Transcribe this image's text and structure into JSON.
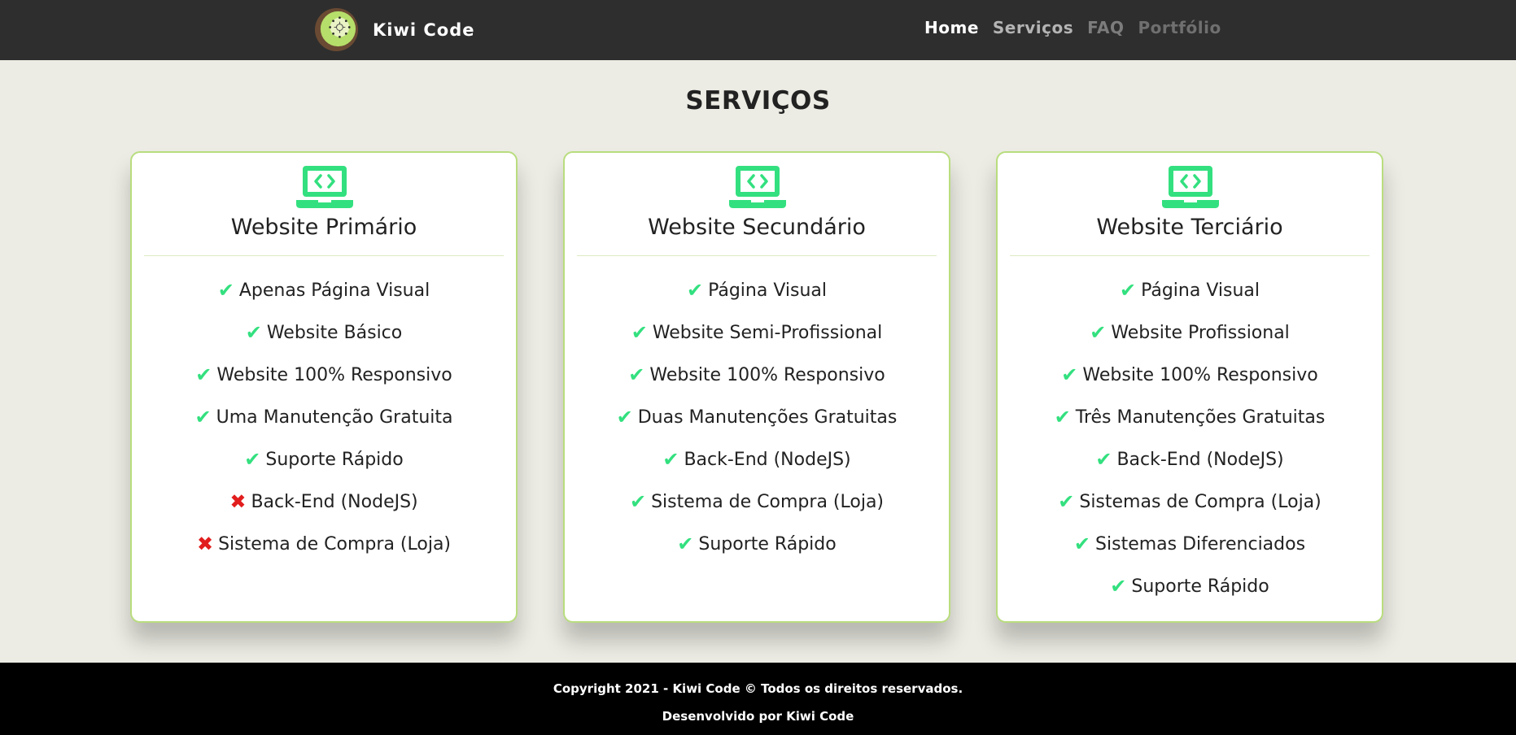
{
  "header": {
    "brand": "Kiwi Code",
    "nav": [
      {
        "label": "Home"
      },
      {
        "label": "Serviços"
      },
      {
        "label": "FAQ"
      },
      {
        "label": "Portfólio"
      }
    ]
  },
  "main": {
    "title": "SERVIÇOS",
    "cards": [
      {
        "title": "Website Primário",
        "icon": "laptop-code-icon",
        "features": [
          {
            "text": "Apenas Página Visual",
            "included": true
          },
          {
            "text": "Website Básico",
            "included": true
          },
          {
            "text": "Website 100% Responsivo",
            "included": true
          },
          {
            "text": "Uma Manutenção Gratuita",
            "included": true
          },
          {
            "text": "Suporte Rápido",
            "included": true
          },
          {
            "text": "Back-End (NodeJS)",
            "included": false
          },
          {
            "text": "Sistema de Compra (Loja)",
            "included": false
          }
        ]
      },
      {
        "title": "Website Secundário",
        "icon": "laptop-code-icon",
        "features": [
          {
            "text": "Página Visual",
            "included": true
          },
          {
            "text": "Website Semi-Profissional",
            "included": true
          },
          {
            "text": "Website 100% Responsivo",
            "included": true
          },
          {
            "text": "Duas Manutenções Gratuitas",
            "included": true
          },
          {
            "text": "Back-End (NodeJS)",
            "included": true
          },
          {
            "text": "Sistema de Compra (Loja)",
            "included": true
          },
          {
            "text": "Suporte Rápido",
            "included": true
          }
        ]
      },
      {
        "title": "Website Terciário",
        "icon": "laptop-code-icon",
        "features": [
          {
            "text": "Página Visual",
            "included": true
          },
          {
            "text": "Website Profissional",
            "included": true
          },
          {
            "text": "Website 100% Responsivo",
            "included": true
          },
          {
            "text": "Três Manutenções Gratuitas",
            "included": true
          },
          {
            "text": "Back-End (NodeJS)",
            "included": true
          },
          {
            "text": "Sistemas de Compra (Loja)",
            "included": true
          },
          {
            "text": "Sistemas Diferenciados",
            "included": true
          },
          {
            "text": "Suporte Rápido",
            "included": true
          }
        ]
      }
    ]
  },
  "footer": {
    "copyright": "Copyright 2021 - Kiwi Code © Todos os direitos reservados.",
    "developed_by": "Desenvolvido por Kiwi Code"
  },
  "colors": {
    "nav_bg": "#2e2e2e",
    "page_bg": "#ecece4",
    "card_border": "#b9dd7e",
    "check": "#33e07f",
    "cross": "#e21d1d",
    "icon": "#33e07f",
    "footer_bg": "#000000"
  }
}
